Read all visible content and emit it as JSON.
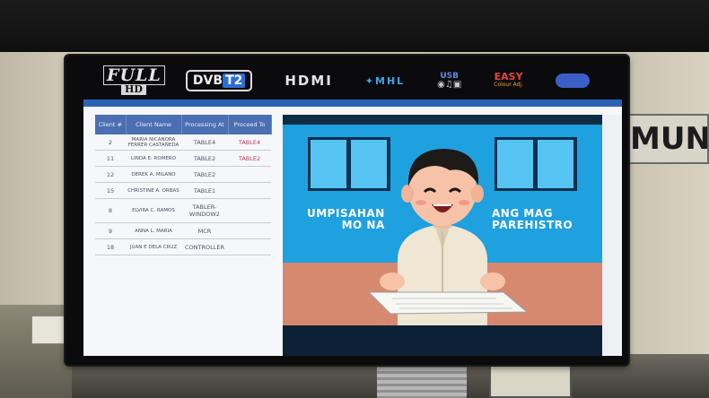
{
  "tv": {
    "logos": {
      "full_hd_top": "FULL",
      "full_hd_bottom": "HD",
      "dvb": "DVB",
      "dvb_t2": "T2",
      "hdmi": "HDMI",
      "mhl": "MHL",
      "usb": "USB",
      "easy": "EASY",
      "easy_sub": "Colour Adj."
    }
  },
  "wall_sign": "MUNI",
  "queue": {
    "headers": [
      "Client #",
      "Client Name",
      "Processing At",
      "Proceed To"
    ],
    "rows": [
      {
        "num": "2",
        "name": "MARIA NICANORA FERRER CASTAÑEDA",
        "processing": "TABLE4",
        "proceed": "TABLE4"
      },
      {
        "num": "11",
        "name": "LINDA E. ROMERO",
        "processing": "TABLE2",
        "proceed": "TABLE2"
      },
      {
        "num": "12",
        "name": "DEREK A. MILANO",
        "processing": "TABLE2",
        "proceed": ""
      },
      {
        "num": "15",
        "name": "CHRISTINE A. ORBAS",
        "processing": "TABLE1",
        "proceed": ""
      },
      {
        "num": "8",
        "name": "ELVIRA C. RAMOS",
        "processing": "TABLER-WINDOW2",
        "proceed": ""
      },
      {
        "num": "9",
        "name": "ANNA L. MARIA",
        "processing": "MCR",
        "proceed": ""
      },
      {
        "num": "18",
        "name": "JUAN E DELA CRUZ",
        "processing": "CONTROLLER",
        "proceed": ""
      }
    ]
  },
  "video": {
    "left_text": [
      "UMPISAHAN",
      "MO NA"
    ],
    "right_text": [
      "ANG MAG",
      "PAREHISTRO"
    ]
  }
}
